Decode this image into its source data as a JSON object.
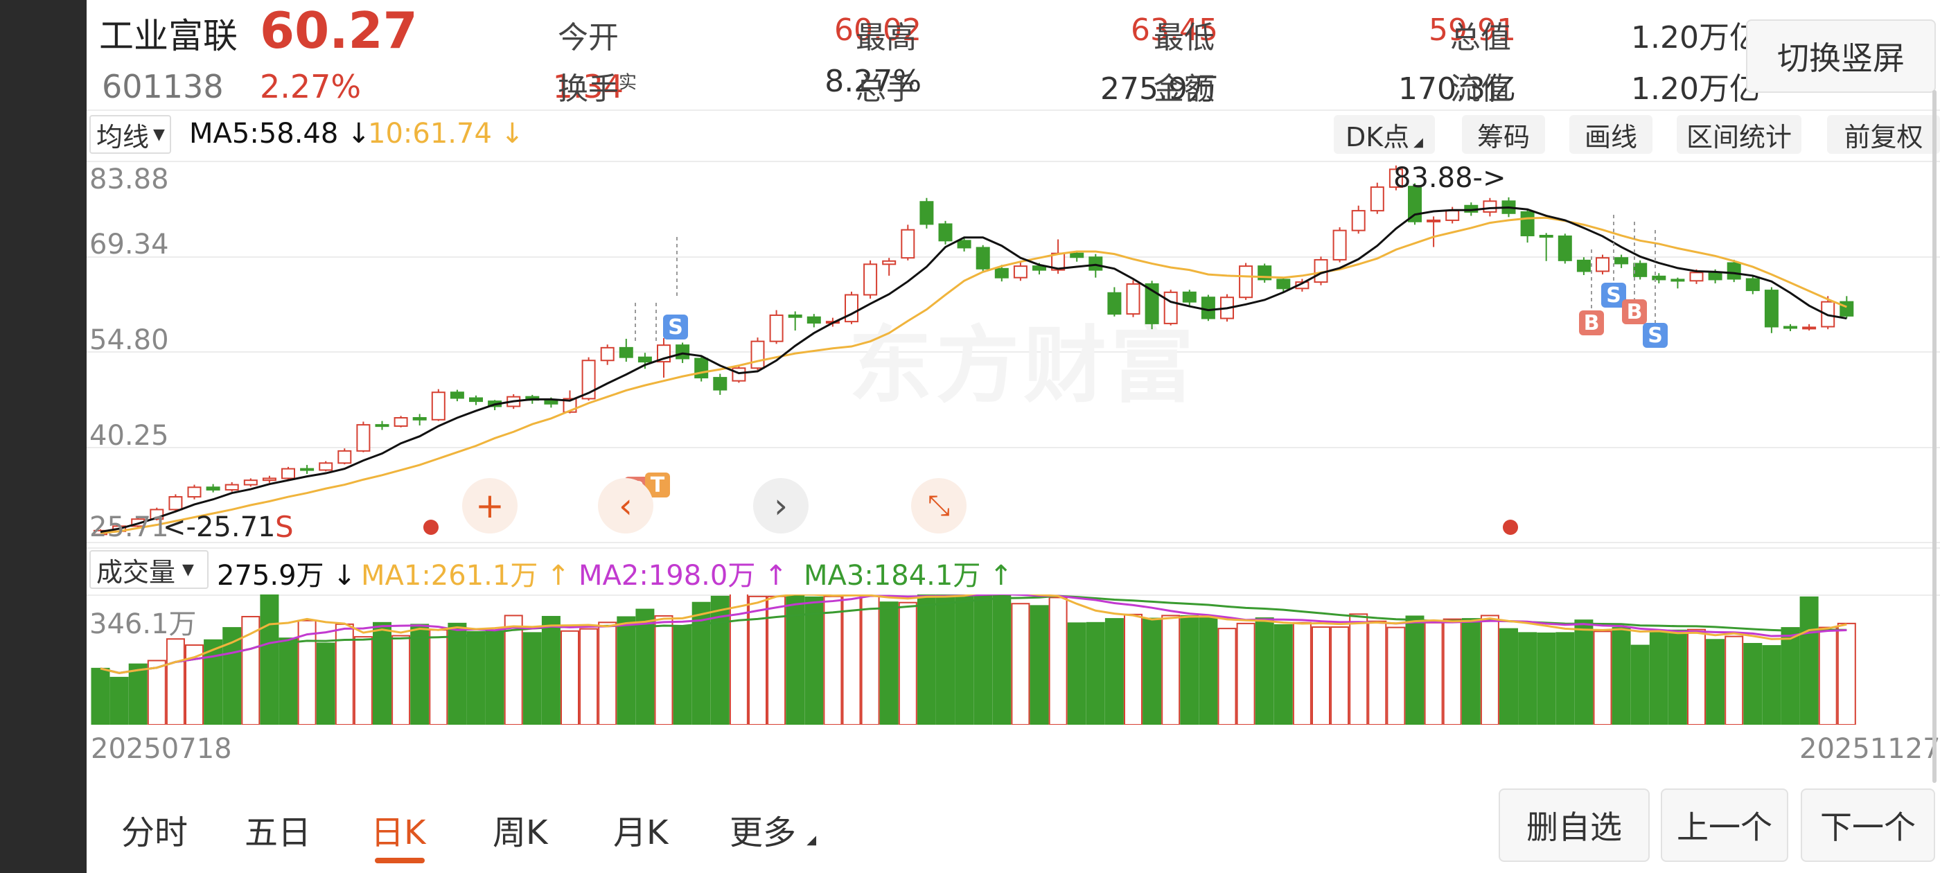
{
  "header": {
    "name": "工业富联",
    "price": "60.27",
    "code": "601138",
    "change_pct": "2.27%",
    "change_abs": "1.34",
    "stats": [
      {
        "label": "今开",
        "value": "60.02"
      },
      {
        "label": "最高",
        "value": "63.45"
      },
      {
        "label": "最低",
        "value": "59.91"
      },
      {
        "label": "总值",
        "value": "1.20万亿"
      },
      {
        "label": "换手",
        "sup": "实",
        "value": "8.27%"
      },
      {
        "label": "总手",
        "value": "275.9万"
      },
      {
        "label": "金额",
        "value": "170.3亿"
      },
      {
        "label": "流值",
        "value": "1.20万亿"
      }
    ],
    "switch_button": "切换竖屏"
  },
  "toolbar": {
    "ma_select": "均线",
    "ma5": "MA5:58.48 ↓",
    "ma10": "10:61.74 ↓",
    "buttons": [
      "DK点",
      "筹码",
      "画线",
      "区间统计",
      "前复权"
    ]
  },
  "price_chart": {
    "y_labels": [
      "83.88",
      "69.34",
      "54.80",
      "40.25",
      "25.71"
    ],
    "high_callout": "83.88->",
    "low_callout": "<-25.71",
    "low_marker": "S",
    "watermark": "东方财富"
  },
  "volume": {
    "select": "成交量",
    "value": "275.9万 ↓",
    "ma1": "MA1:261.1万 ↑",
    "ma2": "MA2:198.0万 ↑",
    "ma3": "MA3:184.1万 ↑",
    "y_top": "346.1万"
  },
  "dates": {
    "start": "20250718",
    "end": "20251127"
  },
  "tabs": [
    "分时",
    "五日",
    "日K",
    "周K",
    "月K",
    "更多"
  ],
  "active_tab": "日K",
  "actions": [
    "删自选",
    "上一个",
    "下一个"
  ],
  "colors": {
    "up": "#d64032",
    "down": "#3b9b2c",
    "ma5": "#111111",
    "ma10": "#f0b43c",
    "vol_ma1": "#f0b43c",
    "vol_ma2": "#c23ad0",
    "vol_ma3": "#3a9b30",
    "active": "#e0561f"
  },
  "chart_data": [
    {
      "type": "candlestick",
      "title": "",
      "ylim": [
        25.71,
        83.88
      ],
      "x_range": [
        "20250718",
        "20251127"
      ],
      "candles": [
        [
          26.0,
          26.6,
          25.9,
          26.8
        ],
        [
          26.5,
          27.3,
          26.3,
          27.6
        ],
        [
          27.3,
          28.4,
          27.1,
          28.7
        ],
        [
          28.4,
          29.9,
          28.2,
          30.2
        ],
        [
          29.9,
          31.9,
          29.6,
          32.3
        ],
        [
          31.9,
          33.4,
          31.5,
          33.8
        ],
        [
          33.4,
          33.0,
          32.6,
          33.9
        ],
        [
          33.0,
          33.8,
          32.7,
          34.2
        ],
        [
          33.8,
          34.5,
          33.5,
          34.8
        ],
        [
          34.5,
          34.8,
          34.1,
          35.2
        ],
        [
          34.8,
          36.3,
          34.6,
          36.6
        ],
        [
          36.3,
          36.1,
          35.5,
          36.9
        ],
        [
          36.1,
          37.2,
          35.9,
          37.5
        ],
        [
          37.2,
          39.1,
          37.0,
          39.5
        ],
        [
          39.1,
          43.2,
          38.9,
          43.7
        ],
        [
          43.2,
          43.0,
          42.4,
          43.8
        ],
        [
          43.0,
          44.3,
          42.8,
          44.6
        ],
        [
          44.3,
          44.0,
          43.1,
          44.9
        ],
        [
          44.0,
          48.3,
          43.8,
          48.8
        ],
        [
          48.3,
          47.4,
          46.9,
          48.7
        ],
        [
          47.4,
          46.9,
          46.3,
          47.8
        ],
        [
          46.9,
          46.1,
          45.5,
          47.1
        ],
        [
          46.1,
          47.6,
          45.7,
          48.0
        ],
        [
          47.6,
          47.1,
          46.5,
          47.9
        ],
        [
          47.1,
          46.5,
          45.9,
          47.5
        ],
        [
          45.2,
          47.3,
          45.0,
          48.6
        ],
        [
          47.3,
          53.3,
          47.0,
          53.8
        ],
        [
          53.3,
          55.3,
          52.6,
          55.8
        ],
        [
          55.3,
          53.8,
          53.1,
          56.7
        ],
        [
          53.8,
          53.1,
          52.0,
          54.5
        ],
        [
          53.1,
          55.7,
          50.6,
          56.8
        ],
        [
          55.7,
          53.6,
          52.9,
          56.1
        ],
        [
          53.6,
          50.6,
          50.0,
          53.9
        ],
        [
          50.6,
          48.7,
          47.9,
          51.2
        ],
        [
          50.1,
          52.1,
          49.8,
          52.6
        ],
        [
          52.1,
          56.3,
          51.8,
          56.9
        ],
        [
          56.3,
          60.4,
          55.9,
          61.2
        ],
        [
          60.4,
          60.1,
          58.0,
          61.0
        ],
        [
          60.1,
          59.2,
          58.5,
          60.6
        ],
        [
          59.2,
          59.4,
          58.6,
          60.0
        ],
        [
          59.4,
          63.6,
          59.0,
          64.1
        ],
        [
          63.6,
          68.4,
          63.0,
          69.0
        ],
        [
          68.4,
          68.9,
          66.6,
          69.4
        ],
        [
          69.4,
          73.8,
          69.0,
          74.6
        ],
        [
          78.2,
          74.7,
          74.0,
          78.8
        ],
        [
          74.7,
          72.1,
          71.5,
          75.2
        ],
        [
          72.1,
          71.0,
          70.4,
          72.5
        ],
        [
          71.0,
          67.7,
          67.1,
          71.4
        ],
        [
          67.7,
          66.3,
          65.7,
          68.3
        ],
        [
          66.3,
          68.1,
          65.8,
          68.8
        ],
        [
          68.1,
          67.5,
          66.8,
          68.6
        ],
        [
          67.5,
          70.1,
          66.9,
          72.3
        ],
        [
          70.1,
          69.5,
          68.8,
          70.5
        ],
        [
          69.5,
          67.5,
          66.3,
          70.0
        ],
        [
          63.9,
          60.6,
          60.2,
          64.8
        ],
        [
          60.6,
          65.3,
          60.1,
          65.9
        ],
        [
          65.3,
          59.1,
          58.2,
          65.8
        ],
        [
          59.1,
          64.0,
          58.8,
          64.4
        ],
        [
          64.0,
          62.5,
          61.9,
          64.4
        ],
        [
          63.2,
          59.9,
          59.5,
          63.6
        ],
        [
          59.9,
          63.2,
          59.4,
          63.7
        ],
        [
          63.2,
          68.1,
          62.8,
          68.6
        ],
        [
          68.1,
          66.0,
          65.5,
          68.5
        ],
        [
          66.0,
          64.6,
          64.1,
          66.4
        ],
        [
          64.6,
          65.6,
          64.1,
          66.1
        ],
        [
          65.6,
          69.1,
          65.1,
          69.6
        ],
        [
          69.1,
          73.7,
          68.7,
          74.2
        ],
        [
          73.7,
          76.8,
          73.2,
          77.6
        ],
        [
          76.8,
          80.5,
          76.3,
          81.2
        ],
        [
          80.5,
          83.3,
          80.0,
          83.9
        ],
        [
          80.6,
          75.1,
          74.6,
          81.1
        ],
        [
          75.1,
          75.3,
          71.1,
          75.9
        ],
        [
          75.3,
          76.8,
          74.8,
          77.4
        ],
        [
          77.6,
          76.6,
          76.0,
          78.1
        ],
        [
          76.6,
          78.3,
          75.9,
          78.8
        ],
        [
          78.3,
          76.4,
          75.8,
          78.9
        ],
        [
          76.6,
          72.9,
          71.8,
          77.1
        ],
        [
          72.9,
          72.8,
          68.9,
          73.3
        ],
        [
          72.8,
          69.0,
          68.5,
          73.2
        ],
        [
          69.0,
          67.3,
          66.7,
          69.5
        ],
        [
          67.3,
          69.4,
          66.8,
          69.9
        ],
        [
          69.4,
          68.5,
          67.8,
          69.9
        ],
        [
          68.5,
          66.5,
          66.0,
          69.0
        ],
        [
          66.5,
          66.0,
          65.4,
          67.0
        ],
        [
          66.0,
          65.8,
          64.6,
          66.3
        ],
        [
          65.8,
          67.1,
          65.3,
          67.6
        ],
        [
          67.1,
          66.0,
          65.4,
          67.6
        ],
        [
          68.6,
          66.1,
          65.6,
          69.1
        ],
        [
          66.1,
          64.3,
          63.7,
          66.6
        ],
        [
          64.3,
          58.6,
          57.6,
          64.8
        ],
        [
          58.6,
          58.5,
          57.9,
          59.0
        ],
        [
          58.5,
          58.5,
          58.0,
          59.0
        ],
        [
          58.6,
          62.5,
          58.2,
          63.4
        ],
        [
          62.5,
          60.3,
          59.9,
          63.4
        ]
      ],
      "ma5": [
        26.4,
        26.9,
        27.7,
        28.6,
        29.6,
        30.7,
        31.5,
        32.5,
        33.1,
        33.9,
        34.5,
        35.1,
        35.6,
        36.3,
        37.6,
        38.7,
        40.3,
        41.4,
        43.0,
        44.3,
        45.4,
        46.4,
        46.9,
        47.2,
        47.2,
        47.0,
        48.2,
        49.7,
        51.1,
        52.6,
        53.6,
        54.4,
        54.0,
        52.5,
        51.3,
        51.6,
        53.3,
        55.6,
        57.6,
        59.2,
        60.6,
        62.2,
        63.7,
        65.7,
        68.0,
        71.1,
        72.6,
        72.6,
        71.3,
        69.4,
        68.3,
        67.7,
        68.0,
        68.3,
        67.7,
        66.1,
        64.3,
        62.5,
        61.8,
        61.2,
        61.5,
        62.1,
        62.8,
        64.0,
        65.4,
        67.0,
        67.8,
        69.2,
        71.3,
        74.0,
        76.2,
        76.7,
        76.9,
        76.9,
        77.2,
        77.3,
        77.0,
        76.0,
        75.3,
        74.1,
        72.8,
        71.1,
        69.6,
        68.6,
        67.8,
        67.3,
        67.2,
        67.0,
        66.6,
        65.7,
        63.9,
        61.9,
        60.4,
        59.9
      ],
      "ma10": [
        26.2,
        26.5,
        27.0,
        27.5,
        28.1,
        28.7,
        29.3,
        29.9,
        30.6,
        31.2,
        31.9,
        32.5,
        33.2,
        33.8,
        34.6,
        35.3,
        36.1,
        36.9,
        37.9,
        38.9,
        39.9,
        41.1,
        42.1,
        43.3,
        44.2,
        45.4,
        46.6,
        47.6,
        48.6,
        49.4,
        50.1,
        50.8,
        51.4,
        51.9,
        52.5,
        53.2,
        53.8,
        54.4,
        54.8,
        55.2,
        55.5,
        56.3,
        57.6,
        59.5,
        61.3,
        63.6,
        65.8,
        67.2,
        68.1,
        68.8,
        69.4,
        70.0,
        70.4,
        70.4,
        70.0,
        69.2,
        68.5,
        67.9,
        67.5,
        66.8,
        66.6,
        66.5,
        66.4,
        66.3,
        66.6,
        67.1,
        67.6,
        68.4,
        69.3,
        70.7,
        71.7,
        72.7,
        73.4,
        74.1,
        74.9,
        75.3,
        75.6,
        75.7,
        75.2,
        74.6,
        73.8,
        72.9,
        72.1,
        71.6,
        70.9,
        70.3,
        69.7,
        68.9,
        68.0,
        66.8,
        65.5,
        64.2,
        62.9,
        61.7
      ]
    },
    {
      "type": "bar",
      "title": "",
      "ylim": [
        0,
        346.1
      ],
      "unit": "万",
      "values": [
        156,
        131,
        168,
        178,
        238,
        221,
        235,
        269,
        300,
        369,
        240,
        289,
        226,
        279,
        244,
        283,
        247,
        278,
        263,
        281,
        258,
        260,
        303,
        255,
        300,
        260,
        266,
        284,
        299,
        320,
        302,
        272,
        339,
        356,
        371,
        356,
        356,
        369,
        354,
        356,
        359,
        357,
        340,
        339,
        380,
        361,
        369,
        390,
        377,
        336,
        330,
        353,
        282,
        283,
        294,
        306,
        295,
        303,
        302,
        296,
        267,
        281,
        296,
        277,
        283,
        271,
        271,
        307,
        287,
        270,
        301,
        283,
        293,
        294,
        303,
        266,
        255,
        254,
        255,
        290,
        259,
        269,
        220,
        261,
        262,
        264,
        236,
        245,
        225,
        219,
        269,
        354,
        270,
        281
      ],
      "up": [
        false,
        false,
        false,
        true,
        true,
        true,
        false,
        false,
        true,
        false,
        false,
        true,
        false,
        true,
        true,
        false,
        true,
        false,
        true,
        false,
        false,
        false,
        true,
        false,
        false,
        true,
        true,
        true,
        false,
        false,
        true,
        false,
        false,
        false,
        true,
        true,
        true,
        false,
        false,
        true,
        true,
        true,
        false,
        true,
        false,
        false,
        false,
        false,
        false,
        true,
        false,
        true,
        false,
        false,
        false,
        true,
        false,
        true,
        false,
        false,
        true,
        true,
        false,
        false,
        true,
        true,
        true,
        true,
        true,
        true,
        false,
        true,
        true,
        false,
        true,
        false,
        false,
        false,
        false,
        false,
        true,
        false,
        false,
        false,
        false,
        true,
        false,
        true,
        false,
        false,
        false,
        false,
        true,
        true
      ]
    }
  ]
}
